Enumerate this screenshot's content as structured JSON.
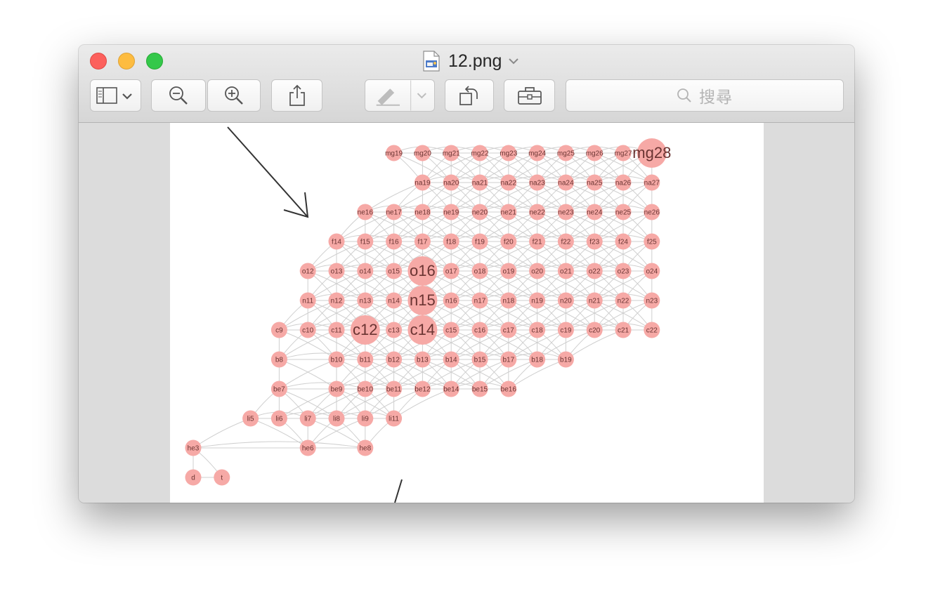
{
  "window": {
    "title": "12.png",
    "traffic_lights": [
      "close-button",
      "minimize-button",
      "zoom-button"
    ]
  },
  "toolbar": {
    "buttons": [
      "sidebar-icon",
      "zoom-out-icon",
      "zoom-in-icon",
      "share-icon",
      "markup-icon",
      "rotate-icon",
      "toolbox-icon"
    ],
    "search_placeholder": "搜尋"
  },
  "colors": {
    "node_fill": "#f6a9a6",
    "node_text": "#6a3432",
    "edge": "#cfcfcf",
    "page_background": "#ffffff",
    "viewer_background": "#dcdcdc"
  },
  "graph": {
    "rows": [
      [
        "mg19",
        "mg20",
        "mg21",
        "mg22",
        "mg23",
        "mg24",
        "mg25",
        "mg26",
        "mg27",
        "mg28"
      ],
      [
        "na19",
        "na20",
        "na21",
        "na22",
        "na23",
        "na24",
        "na25",
        "na26",
        "na27"
      ],
      [
        "ne16",
        "ne17",
        "ne18",
        "ne19",
        "ne20",
        "ne21",
        "ne22",
        "ne23",
        "ne24",
        "ne25",
        "ne26"
      ],
      [
        "f14",
        "f15",
        "f16",
        "f17",
        "f18",
        "f19",
        "f20",
        "f21",
        "f22",
        "f23",
        "f24",
        "f25"
      ],
      [
        "o12",
        "o13",
        "o14",
        "o15",
        "o16",
        "o17",
        "o18",
        "o19",
        "o20",
        "o21",
        "o22",
        "o23",
        "o24"
      ],
      [
        "n11",
        "n12",
        "n13",
        "n14",
        "n15",
        "n16",
        "n17",
        "n18",
        "n19",
        "n20",
        "n21",
        "n22",
        "n23"
      ],
      [
        "c9",
        "c10",
        "c11",
        "c12",
        "c13",
        "c14",
        "c15",
        "c16",
        "c17",
        "c18",
        "c19",
        "c20",
        "c21",
        "c22"
      ],
      [
        "b8",
        "b10",
        "b11",
        "b12",
        "b13",
        "b14",
        "b15",
        "b17",
        "b18",
        "b19"
      ],
      [
        "be7",
        "be9",
        "be10",
        "be11",
        "be12",
        "be14",
        "be15",
        "be16"
      ],
      [
        "li5",
        "li6",
        "li7",
        "li8",
        "li9",
        "li11"
      ],
      [
        "he3",
        "he6",
        "he8"
      ],
      [
        "d",
        "t"
      ]
    ],
    "highlighted": [
      "mg28",
      "o16",
      "n15",
      "c12",
      "c14"
    ]
  }
}
